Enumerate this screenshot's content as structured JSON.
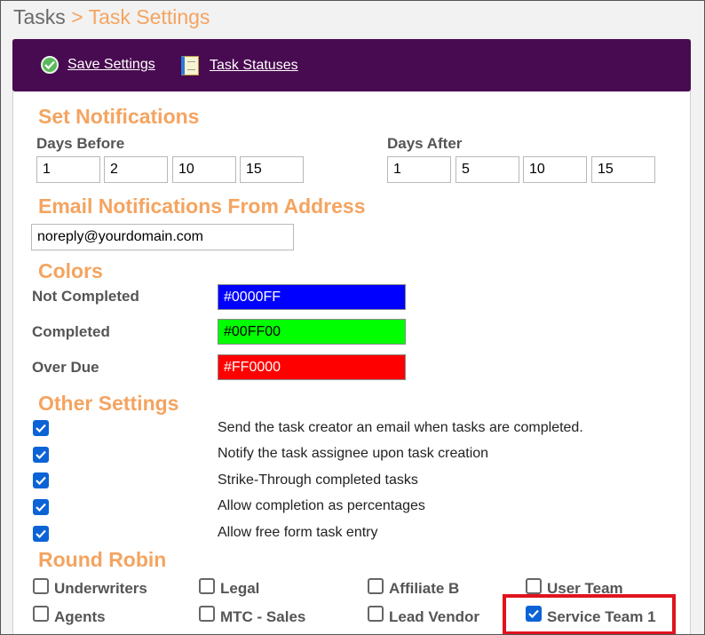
{
  "breadcrumb": {
    "parent": "Tasks",
    "separator": ">",
    "current": "Task Settings"
  },
  "toolbar": {
    "save_label": "Save Settings",
    "statuses_label": "Task Statuses"
  },
  "notifications": {
    "title": "Set Notifications",
    "days_before_label": "Days Before",
    "days_before": [
      "1",
      "2",
      "10",
      "15"
    ],
    "days_after_label": "Days After",
    "days_after": [
      "1",
      "5",
      "10",
      "15"
    ]
  },
  "email": {
    "title": "Email Notifications From Address",
    "value": "noreply@yourdomain.com"
  },
  "colors": {
    "title": "Colors",
    "items": [
      {
        "label": "Not Completed",
        "value": "#0000FF",
        "bg": "#0000FF",
        "fg": "#ffffff"
      },
      {
        "label": "Completed",
        "value": "#00FF00",
        "bg": "#00FF00",
        "fg": "#000000"
      },
      {
        "label": "Over Due",
        "value": "#FF0000",
        "bg": "#FF0000",
        "fg": "#ffffff"
      }
    ]
  },
  "other": {
    "title": "Other Settings",
    "items": [
      {
        "label": "Send the task creator an email when tasks are completed.",
        "checked": true
      },
      {
        "label": "Notify the task assignee upon task creation",
        "checked": true
      },
      {
        "label": "Strike-Through completed tasks",
        "checked": true
      },
      {
        "label": "Allow completion as percentages",
        "checked": true
      },
      {
        "label": "Allow free form task entry",
        "checked": true
      }
    ]
  },
  "round_robin": {
    "title": "Round Robin",
    "items": [
      {
        "label": "Underwriters",
        "checked": false
      },
      {
        "label": "Legal",
        "checked": false
      },
      {
        "label": "Affiliate B",
        "checked": false
      },
      {
        "label": "User Team",
        "checked": false
      },
      {
        "label": "Agents",
        "checked": false
      },
      {
        "label": "MTC - Sales",
        "checked": false
      },
      {
        "label": "Lead Vendor",
        "checked": false
      },
      {
        "label": "Service Team 1",
        "checked": true
      }
    ]
  }
}
